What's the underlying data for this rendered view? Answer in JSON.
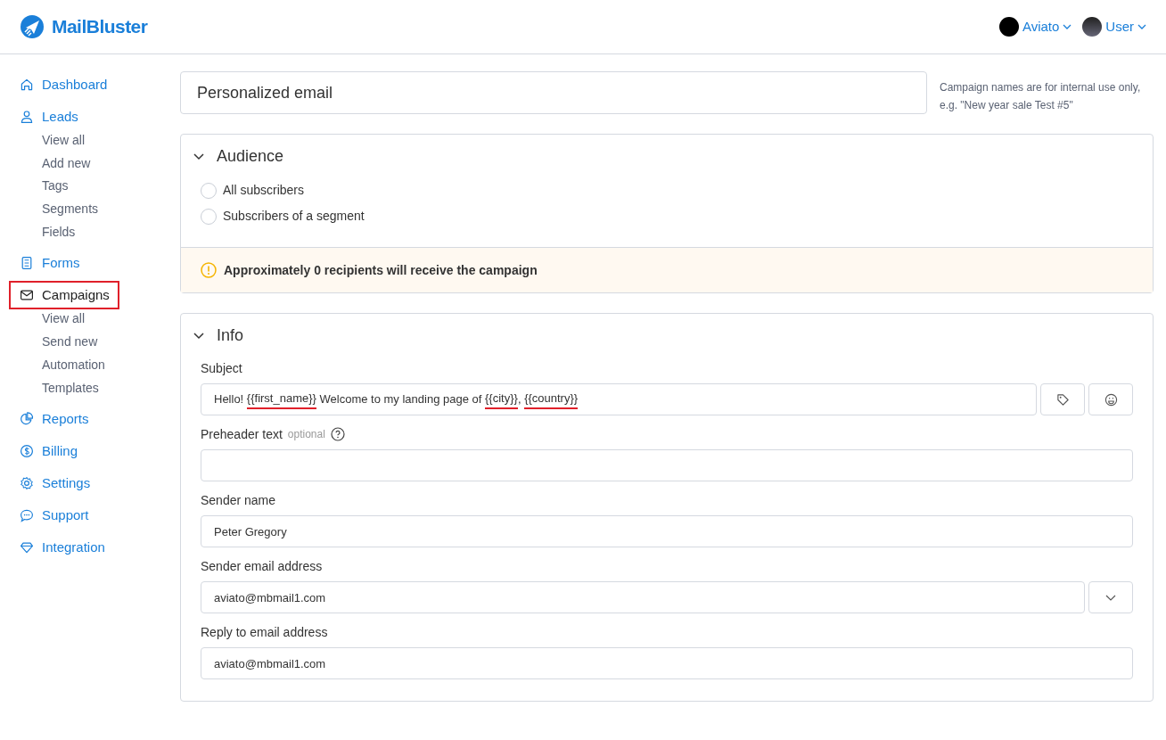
{
  "header": {
    "logo": "MailBluster",
    "accounts": [
      {
        "kind": "team",
        "label": "Aviato"
      },
      {
        "kind": "user",
        "label": "User"
      }
    ]
  },
  "sidebar": {
    "items": [
      {
        "label": "Dashboard",
        "selected": false,
        "highlighted": false
      },
      {
        "label": "Leads",
        "selected": false,
        "highlighted": false,
        "children": [
          "View all",
          "Add new",
          "Tags",
          "Segments",
          "Fields"
        ]
      },
      {
        "label": "Forms",
        "selected": false,
        "highlighted": false
      },
      {
        "label": "Campaigns",
        "selected": true,
        "highlighted": true,
        "children": [
          "View all",
          "Send new",
          "Automation",
          "Templates"
        ]
      },
      {
        "label": "Reports",
        "selected": false,
        "highlighted": false
      },
      {
        "label": "Billing",
        "selected": false,
        "highlighted": false
      },
      {
        "label": "Settings",
        "selected": false,
        "highlighted": false
      },
      {
        "label": "Support",
        "selected": false,
        "highlighted": false
      },
      {
        "label": "Integration",
        "selected": false,
        "highlighted": false
      }
    ]
  },
  "campaign_name": {
    "value": "Personalized email",
    "hint": "Campaign names are for internal use only, e.g. \"New year sale Test #5\""
  },
  "audience": {
    "title": "Audience",
    "expanded": true,
    "options": [
      {
        "label": "All subscribers",
        "selected": false
      },
      {
        "label": "Subscribers of a segment",
        "selected": false
      }
    ],
    "notice": "Approximately 0 recipients will receive the campaign"
  },
  "info": {
    "title": "Info",
    "expanded": true,
    "fields": [
      {
        "kind": "subject",
        "label": "Subject",
        "segments": [
          {
            "text": "Hello! ",
            "marked": false
          },
          {
            "text": "{{first_name}}",
            "marked": true
          },
          {
            "text": " Welcome to my landing page of ",
            "marked": false
          },
          {
            "text": "{{city}}",
            "marked": true
          },
          {
            "text": ", ",
            "marked": false
          },
          {
            "text": "{{country}}",
            "marked": true
          }
        ]
      },
      {
        "kind": "text",
        "label": "Preheader text",
        "note": "optional"
      },
      {
        "kind": "text",
        "label": "Sender name",
        "value": "Peter Gregory"
      },
      {
        "kind": "select",
        "label": "Sender email address",
        "value": "aviato@mbmail1.com"
      },
      {
        "kind": "text",
        "label": "Reply to email address",
        "value": "aviato@mbmail1.com"
      }
    ]
  }
}
